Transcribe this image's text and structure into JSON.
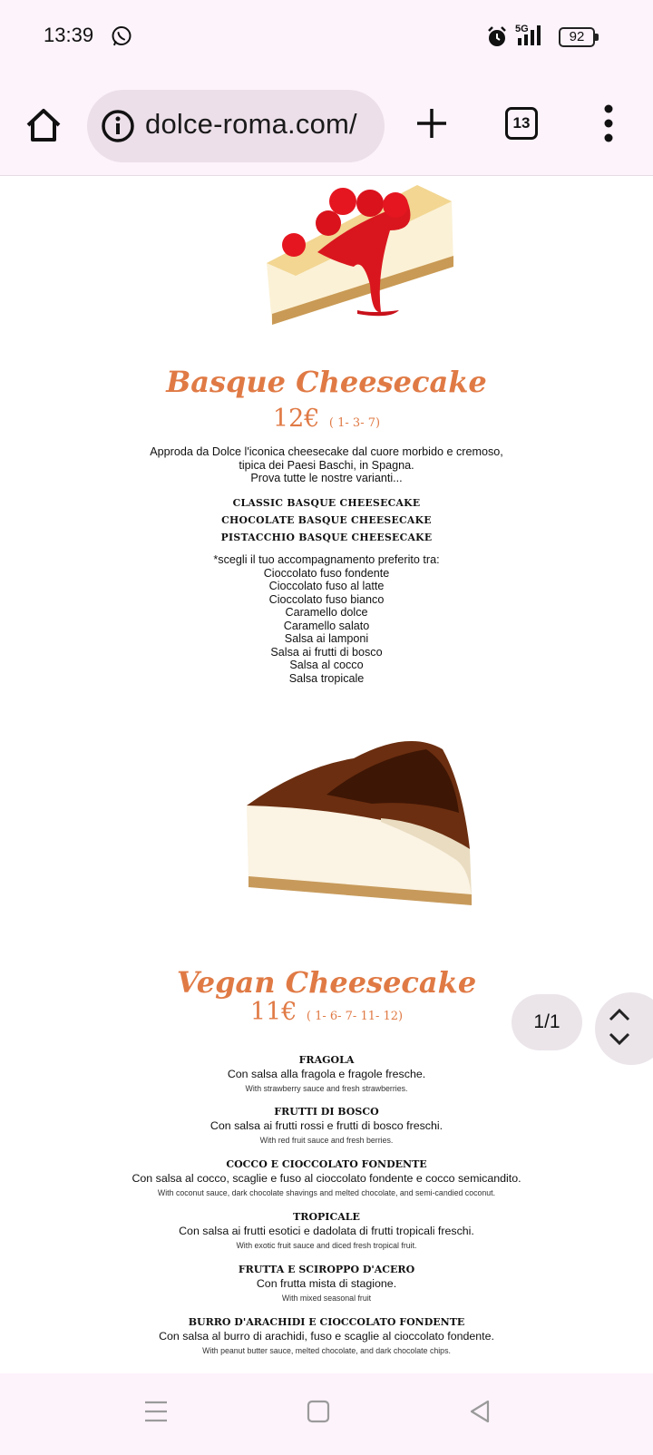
{
  "status_bar": {
    "time": "13:39",
    "network": "5G",
    "battery": "92"
  },
  "browser": {
    "url": "dolce-roma.com/",
    "tab_count": "13"
  },
  "basque": {
    "title": "Basque Cheesecake",
    "price": "12€",
    "allergens": "( 1- 3- 7)",
    "description": [
      "Approda da Dolce l'iconica cheesecake dal cuore morbido e cremoso,",
      "tipica dei Paesi Baschi, in Spagna.",
      "Prova tutte le nostre varianti..."
    ],
    "variants": [
      "Classic Basque Cheesecake",
      "Chocolate Basque Cheesecake",
      "Pistacchio Basque Cheesecake"
    ],
    "toppings_intro": "*scegli il tuo accompagnamento preferito tra:",
    "toppings": [
      "Cioccolato fuso fondente",
      "Cioccolato fuso al latte",
      "Cioccolato fuso bianco",
      "Caramello dolce",
      "Caramello salato",
      "Salsa ai lamponi",
      "Salsa ai frutti di bosco",
      "Salsa al cocco",
      "Salsa tropicale"
    ]
  },
  "vegan": {
    "title": "Vegan Cheesecake",
    "price": "11€",
    "allergens": "( 1- 6- 7- 11- 12)",
    "flavors": [
      {
        "name": "Fragola",
        "it": "Con salsa alla fragola e fragole fresche.",
        "en": "With strawberry sauce and fresh strawberries."
      },
      {
        "name": "Frutti di bosco",
        "it": "Con salsa ai frutti rossi e frutti di bosco freschi.",
        "en": "With red fruit sauce and fresh berries."
      },
      {
        "name": "Cocco e cioccolato fondente",
        "it": "Con salsa al cocco, scaglie e fuso al cioccolato fondente e cocco semicandito.",
        "en": "With coconut sauce, dark chocolate shavings and melted chocolate, and semi-candied coconut."
      },
      {
        "name": "Tropicale",
        "it": "Con salsa ai frutti esotici e dadolata di frutti tropicali freschi.",
        "en": "With exotic fruit sauce and diced fresh tropical fruit."
      },
      {
        "name": "Frutta e sciroppo d'acero",
        "it": "Con frutta mista di stagione.",
        "en": "With mixed seasonal fruit"
      },
      {
        "name": "Burro d'arachidi e cioccolato fondente",
        "it": "Con salsa al burro di arachidi, fuso e scaglie al cioccolato fondente.",
        "en": "With peanut butter sauce, melted chocolate, and dark chocolate chips."
      }
    ]
  },
  "find_in_page": {
    "counter": "1/1"
  },
  "colors": {
    "accent": "#e07a45",
    "chrome_bg": "#fdf3fb",
    "url_pill": "#ecdfe9"
  },
  "icons": [
    "whatsapp-icon",
    "alarm-icon",
    "signal-icon",
    "home-icon",
    "info-icon",
    "plus-icon",
    "tabs-icon",
    "more-vert-icon",
    "chevron-up-icon",
    "chevron-down-icon",
    "menu-lines-icon",
    "square-icon",
    "back-triangle-icon"
  ]
}
